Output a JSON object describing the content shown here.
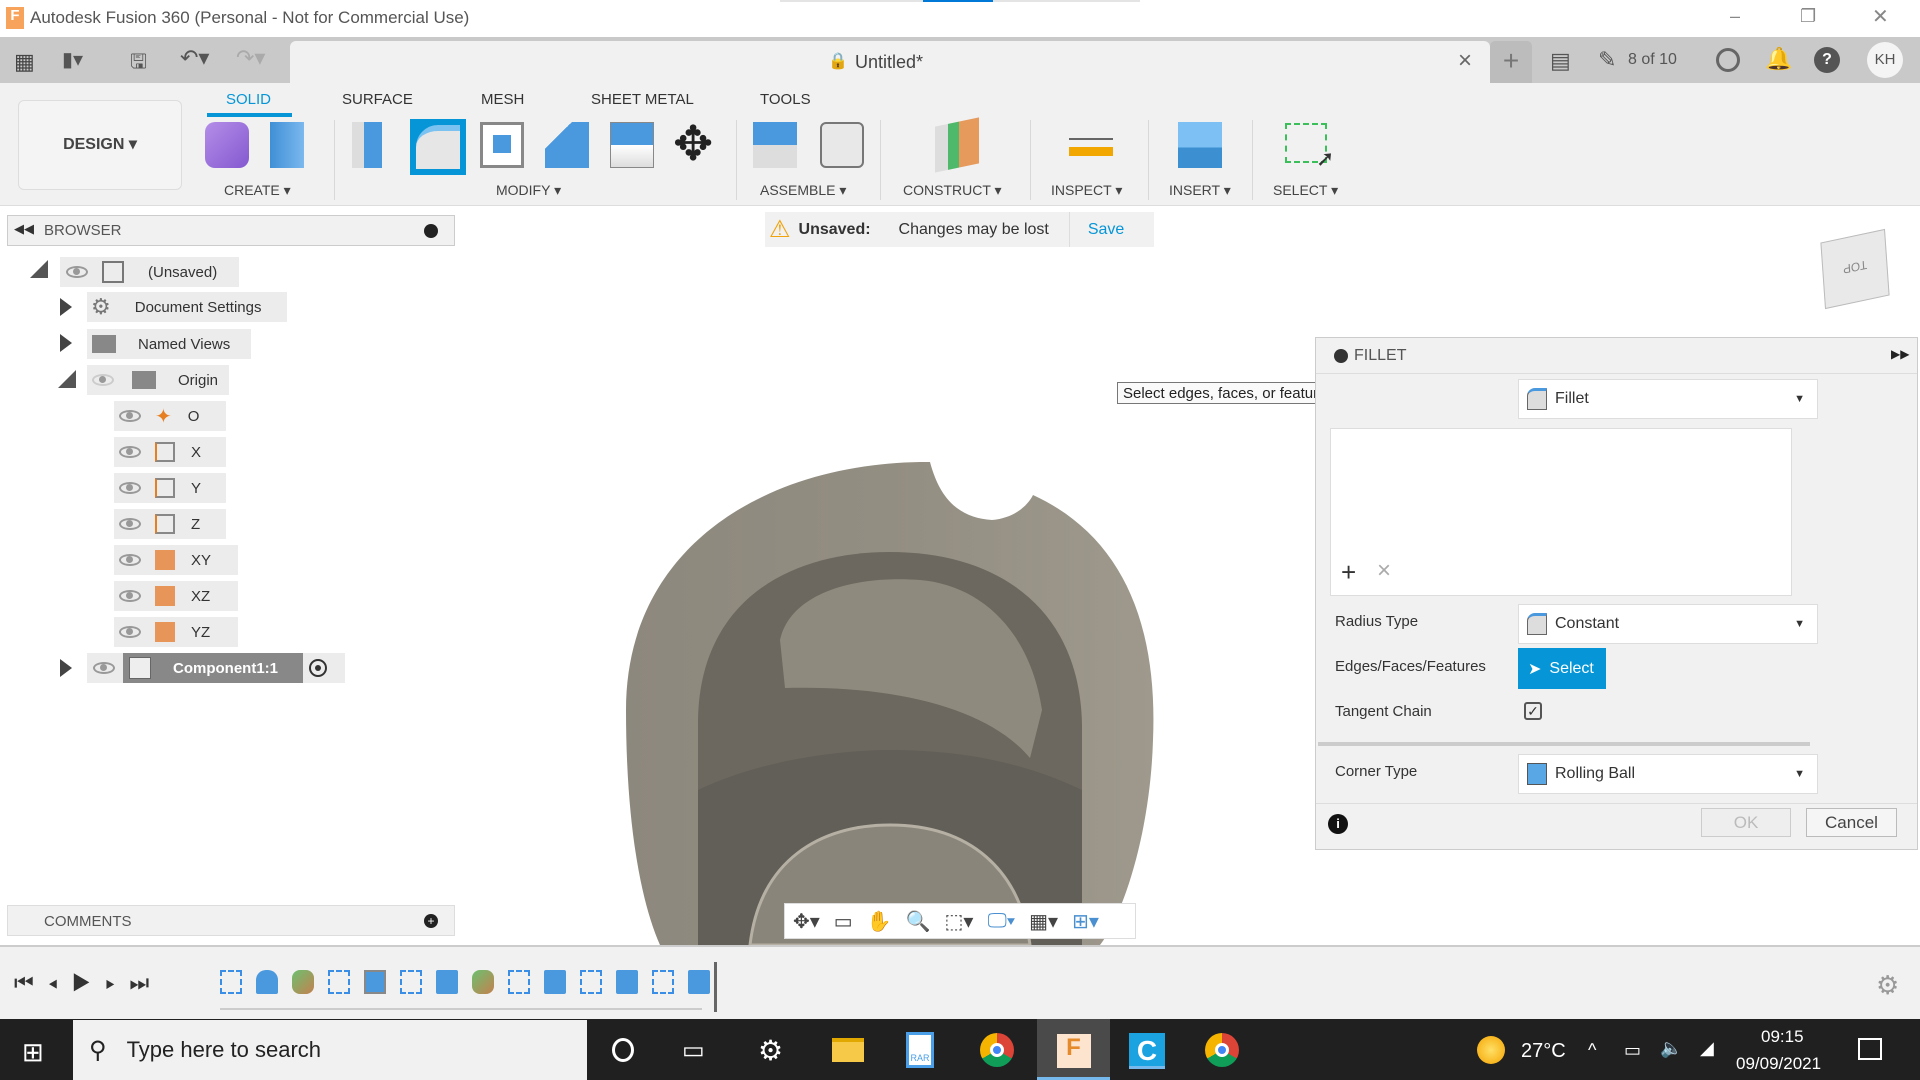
{
  "window": {
    "title": "Autodesk Fusion 360 (Personal - Not for Commercial Use)",
    "minimize": "–",
    "restore": "❐",
    "close": "✕"
  },
  "tabbar": {
    "doc_title": "Untitled*",
    "close": "×",
    "new_tab": "+",
    "doc_count": "8 of 10",
    "user_initials": "KH"
  },
  "workspace": {
    "label": "DESIGN ▾"
  },
  "ribbon_tabs": [
    {
      "label": "SOLID",
      "active": true
    },
    {
      "label": "SURFACE"
    },
    {
      "label": "MESH"
    },
    {
      "label": "SHEET METAL"
    },
    {
      "label": "TOOLS"
    }
  ],
  "ribbon_groups": {
    "create": "CREATE ▾",
    "modify": "MODIFY ▾",
    "assemble": "ASSEMBLE ▾",
    "construct": "CONSTRUCT ▾",
    "inspect": "INSPECT ▾",
    "insert": "INSERT ▾",
    "select": "SELECT ▾"
  },
  "browser": {
    "title": "BROWSER",
    "items": [
      {
        "label": "(Unsaved)"
      },
      {
        "label": "Document Settings"
      },
      {
        "label": "Named Views"
      },
      {
        "label": "Origin"
      },
      {
        "label": "O"
      },
      {
        "label": "X"
      },
      {
        "label": "Y"
      },
      {
        "label": "Z"
      },
      {
        "label": "XY"
      },
      {
        "label": "XZ"
      },
      {
        "label": "YZ"
      },
      {
        "label": "Component1:1"
      }
    ]
  },
  "comments": {
    "title": "COMMENTS"
  },
  "unsaved_bar": {
    "label": "Unsaved:",
    "message": "Changes may be lost",
    "save": "Save"
  },
  "tooltip": "Select edges, faces, or features to fillet",
  "viewcube": {
    "face": "TOP"
  },
  "fillet": {
    "title": "FILLET",
    "type_value": "Fillet",
    "add": "+",
    "remove": "×",
    "radius_type_label": "Radius Type",
    "radius_type_value": "Constant",
    "edges_label": "Edges/Faces/Features",
    "select_button": "Select",
    "tangent_chain_label": "Tangent Chain",
    "tangent_chain_checked": true,
    "corner_type_label": "Corner Type",
    "corner_type_value": "Rolling Ball",
    "ok": "OK",
    "cancel": "Cancel"
  },
  "taskbar": {
    "search_placeholder": "Type here to search",
    "temperature": "27°C",
    "time": "09:15",
    "date": "09/09/2021"
  },
  "colors": {
    "accent": "#0696d7",
    "model": "#8a857a",
    "taskbar": "#202020"
  }
}
